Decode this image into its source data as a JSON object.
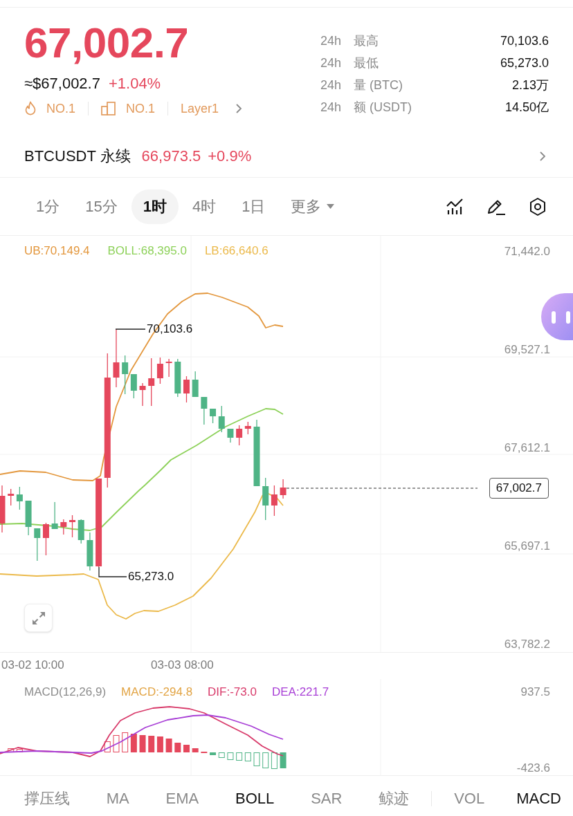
{
  "header": {
    "last_price": "67,002.7",
    "usd_price": "≈$67,002.7",
    "change": "+1.04%",
    "tags": [
      {
        "kind": "hot",
        "label": "NO.1"
      },
      {
        "kind": "sector",
        "label": "NO.1"
      },
      {
        "kind": "category",
        "label": "Layer1"
      }
    ]
  },
  "stats": [
    {
      "period": "24h",
      "label": "最高",
      "value": "70,103.6"
    },
    {
      "period": "24h",
      "label": "最低",
      "value": "65,273.0"
    },
    {
      "period": "24h",
      "label": "量 (BTC)",
      "value": "2.13万"
    },
    {
      "period": "24h",
      "label": "额 (USDT)",
      "value": "14.50亿"
    }
  ],
  "perpetual": {
    "name": "BTCUSDT 永续",
    "price": "66,973.5",
    "change": "+0.9%"
  },
  "intervals": [
    {
      "label": "1分",
      "kind": "interval",
      "selected": false
    },
    {
      "label": "15分",
      "kind": "interval",
      "selected": false
    },
    {
      "label": "1时",
      "kind": "interval",
      "selected": true
    },
    {
      "label": "4时",
      "kind": "interval",
      "selected": false
    },
    {
      "label": "1日",
      "kind": "interval",
      "selected": false
    },
    {
      "label": "更多",
      "kind": "dropdown",
      "selected": false
    }
  ],
  "chart": {
    "legend": [
      {
        "text": "UB:70,149.4",
        "color": "#e3973d"
      },
      {
        "text": "BOLL:68,395.0",
        "color": "#8dd159"
      },
      {
        "text": "LB:66,640.6",
        "color": "#ebb94a"
      }
    ],
    "y_axis": [
      "71,442.0",
      "69,527.1",
      "67,612.1",
      "65,697.1",
      "63,782.2"
    ],
    "high_marker": "70,103.6",
    "low_marker": "65,273.0",
    "last_price_tag": "67,002.7",
    "x_axis": [
      "03-02 10:00",
      "03-03 08:00"
    ]
  },
  "macd": {
    "legend": [
      {
        "text": "MACD(12,26,9)",
        "color": "#8c8c8c"
      },
      {
        "text": "MACD:-294.8",
        "color": "#e2a444"
      },
      {
        "text": "DIF:-73.0",
        "color": "#d83a6a"
      },
      {
        "text": "DEA:221.7",
        "color": "#a83fd6"
      }
    ],
    "y_axis": [
      "937.5",
      "-423.6"
    ]
  },
  "indicators": [
    {
      "label": "撑压线",
      "kind": "overlay",
      "selected": false
    },
    {
      "label": "MA",
      "kind": "overlay",
      "selected": false
    },
    {
      "label": "EMA",
      "kind": "overlay",
      "selected": false
    },
    {
      "label": "BOLL",
      "kind": "overlay",
      "selected": true
    },
    {
      "label": "SAR",
      "kind": "overlay",
      "selected": false
    },
    {
      "label": "鲸迹",
      "kind": "overlay",
      "selected": false
    },
    {
      "label": "VOL",
      "kind": "panel",
      "selected": false
    },
    {
      "label": "MACD",
      "kind": "panel",
      "selected": true
    }
  ]
}
